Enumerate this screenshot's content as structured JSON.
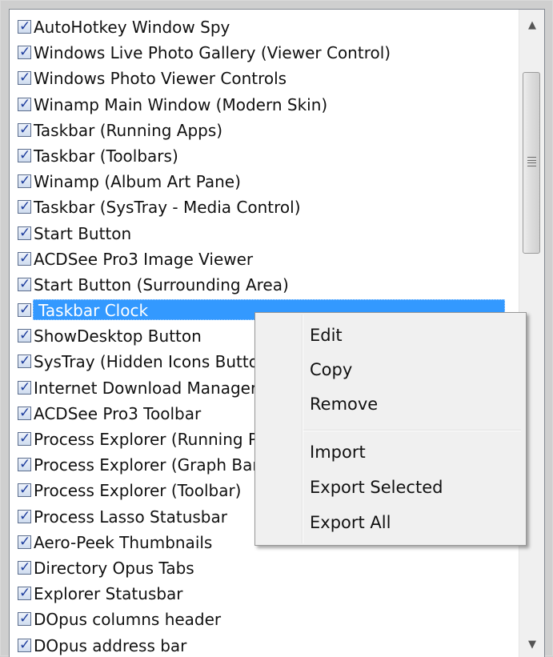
{
  "list": {
    "items": [
      {
        "label": "AutoHotkey Window Spy",
        "checked": true
      },
      {
        "label": "Windows Live Photo Gallery (Viewer Control)",
        "checked": true
      },
      {
        "label": "Windows Photo Viewer Controls",
        "checked": true
      },
      {
        "label": "Winamp Main Window (Modern Skin)",
        "checked": true
      },
      {
        "label": "Taskbar (Running Apps)",
        "checked": true
      },
      {
        "label": "Taskbar (Toolbars)",
        "checked": true
      },
      {
        "label": "Winamp (Album Art Pane)",
        "checked": true
      },
      {
        "label": "Taskbar (SysTray - Media Control)",
        "checked": true
      },
      {
        "label": "Start Button",
        "checked": true
      },
      {
        "label": "ACDSee Pro3 Image Viewer",
        "checked": true
      },
      {
        "label": "Start Button (Surrounding Area)",
        "checked": true
      },
      {
        "label": "Taskbar Clock",
        "checked": true,
        "selected": true
      },
      {
        "label": "ShowDesktop Button",
        "checked": true
      },
      {
        "label": "SysTray (Hidden Icons Butto",
        "checked": true
      },
      {
        "label": "Internet Download Manager",
        "checked": true
      },
      {
        "label": "ACDSee Pro3 Toolbar",
        "checked": true
      },
      {
        "label": "Process Explorer (Running P",
        "checked": true
      },
      {
        "label": "Process Explorer (Graph Bar",
        "checked": true
      },
      {
        "label": "Process Explorer (Toolbar)",
        "checked": true
      },
      {
        "label": "Process Lasso Statusbar",
        "checked": true
      },
      {
        "label": "Aero-Peek Thumbnails",
        "checked": true
      },
      {
        "label": "Directory Opus Tabs",
        "checked": true
      },
      {
        "label": "Explorer Statusbar",
        "checked": true
      },
      {
        "label": "DOpus columns header",
        "checked": true
      },
      {
        "label": "DOpus address bar",
        "checked": true
      }
    ]
  },
  "context_menu": {
    "edit": "Edit",
    "copy": "Copy",
    "remove": "Remove",
    "import": "Import",
    "export_selected": "Export Selected",
    "export_all": "Export All"
  },
  "scrollbar": {
    "up_icon": "▲",
    "down_icon": "▼"
  },
  "colors": {
    "selection": "#3399ff",
    "menu_bg": "#f0f0f0"
  }
}
